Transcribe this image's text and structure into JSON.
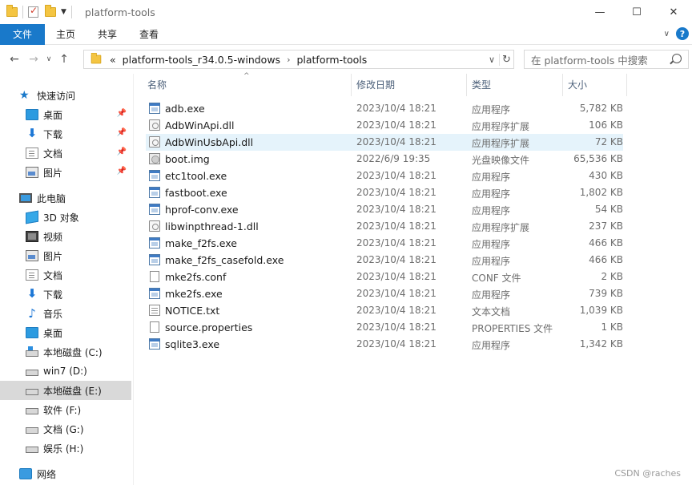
{
  "window": {
    "title": "platform-tools",
    "controls": {
      "minimize": "—",
      "maximize": "☐",
      "close": "✕"
    }
  },
  "ribbon": {
    "tabs": [
      "文件",
      "主页",
      "共享",
      "查看"
    ],
    "help_label": "?",
    "expand_label": "∨"
  },
  "navigation": {
    "back": "←",
    "forward": "→",
    "recent": "∨",
    "up": "↑",
    "overflow": "«",
    "breadcrumb": [
      "platform-tools_r34.0.5-windows",
      "platform-tools"
    ],
    "crumb_separator": "›",
    "dropdown": "∨",
    "refresh": "↻",
    "search_placeholder": "在 platform-tools 中搜索"
  },
  "sidebar": {
    "quick_access": {
      "label": "快速访问",
      "items": [
        {
          "label": "桌面",
          "icon": "desktop-icon"
        },
        {
          "label": "下载",
          "icon": "download-icon"
        },
        {
          "label": "文档",
          "icon": "documents-icon"
        },
        {
          "label": "图片",
          "icon": "pictures-icon"
        }
      ]
    },
    "this_pc": {
      "label": "此电脑",
      "items": [
        {
          "label": "3D 对象",
          "icon": "3d-objects-icon"
        },
        {
          "label": "视频",
          "icon": "videos-icon"
        },
        {
          "label": "图片",
          "icon": "pictures-icon"
        },
        {
          "label": "文档",
          "icon": "documents-icon"
        },
        {
          "label": "下载",
          "icon": "download-icon"
        },
        {
          "label": "音乐",
          "icon": "music-icon"
        },
        {
          "label": "桌面",
          "icon": "desktop-icon"
        },
        {
          "label": "本地磁盘 (C:)",
          "icon": "system-drive-icon"
        },
        {
          "label": "win7 (D:)",
          "icon": "drive-icon"
        },
        {
          "label": "本地磁盘 (E:)",
          "icon": "drive-icon"
        },
        {
          "label": "软件 (F:)",
          "icon": "drive-icon"
        },
        {
          "label": "文档 (G:)",
          "icon": "drive-icon"
        },
        {
          "label": "娱乐 (H:)",
          "icon": "drive-icon"
        }
      ]
    },
    "network": {
      "label": "网络",
      "icon": "network-icon"
    },
    "pin_glyph": "📌"
  },
  "columns": {
    "name": "名称",
    "date": "修改日期",
    "type": "类型",
    "size": "大小",
    "sort_indicator": "^"
  },
  "files": [
    {
      "name": "adb.exe",
      "date": "2023/10/4 18:21",
      "type": "应用程序",
      "size": "5,782 KB",
      "kind": "exe"
    },
    {
      "name": "AdbWinApi.dll",
      "date": "2023/10/4 18:21",
      "type": "应用程序扩展",
      "size": "106 KB",
      "kind": "dll"
    },
    {
      "name": "AdbWinUsbApi.dll",
      "date": "2023/10/4 18:21",
      "type": "应用程序扩展",
      "size": "72 KB",
      "kind": "dll"
    },
    {
      "name": "boot.img",
      "date": "2022/6/9 19:35",
      "type": "光盘映像文件",
      "size": "65,536 KB",
      "kind": "img"
    },
    {
      "name": "etc1tool.exe",
      "date": "2023/10/4 18:21",
      "type": "应用程序",
      "size": "430 KB",
      "kind": "exe"
    },
    {
      "name": "fastboot.exe",
      "date": "2023/10/4 18:21",
      "type": "应用程序",
      "size": "1,802 KB",
      "kind": "exe"
    },
    {
      "name": "hprof-conv.exe",
      "date": "2023/10/4 18:21",
      "type": "应用程序",
      "size": "54 KB",
      "kind": "exe"
    },
    {
      "name": "libwinpthread-1.dll",
      "date": "2023/10/4 18:21",
      "type": "应用程序扩展",
      "size": "237 KB",
      "kind": "dll"
    },
    {
      "name": "make_f2fs.exe",
      "date": "2023/10/4 18:21",
      "type": "应用程序",
      "size": "466 KB",
      "kind": "exe"
    },
    {
      "name": "make_f2fs_casefold.exe",
      "date": "2023/10/4 18:21",
      "type": "应用程序",
      "size": "466 KB",
      "kind": "exe"
    },
    {
      "name": "mke2fs.conf",
      "date": "2023/10/4 18:21",
      "type": "CONF 文件",
      "size": "2 KB",
      "kind": "blank"
    },
    {
      "name": "mke2fs.exe",
      "date": "2023/10/4 18:21",
      "type": "应用程序",
      "size": "739 KB",
      "kind": "exe"
    },
    {
      "name": "NOTICE.txt",
      "date": "2023/10/4 18:21",
      "type": "文本文档",
      "size": "1,039 KB",
      "kind": "txt"
    },
    {
      "name": "source.properties",
      "date": "2023/10/4 18:21",
      "type": "PROPERTIES 文件",
      "size": "1 KB",
      "kind": "blank"
    },
    {
      "name": "sqlite3.exe",
      "date": "2023/10/4 18:21",
      "type": "应用程序",
      "size": "1,342 KB",
      "kind": "exe"
    }
  ],
  "watermark": "CSDN @raches"
}
